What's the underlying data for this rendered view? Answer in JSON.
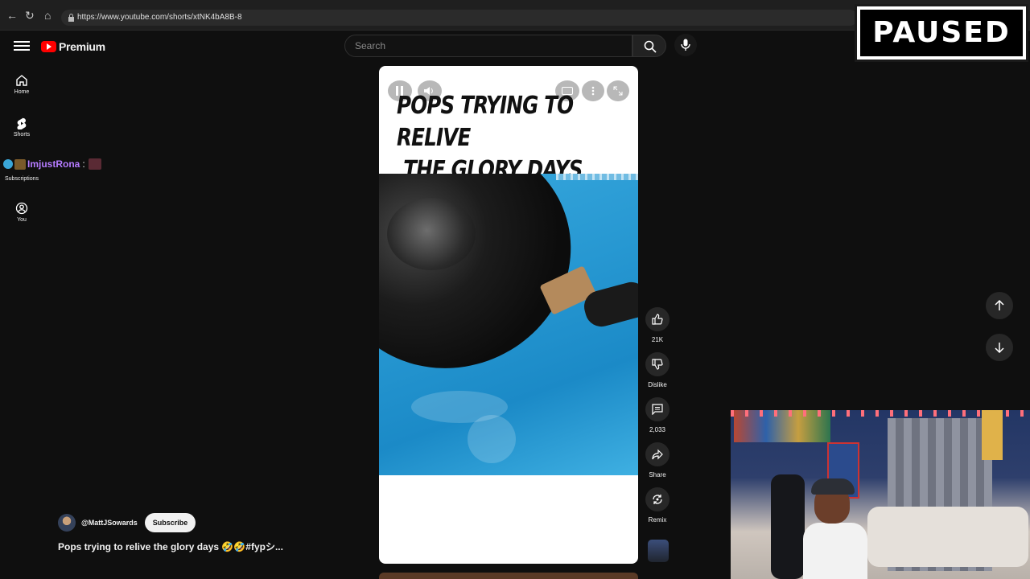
{
  "browser": {
    "url": "https://www.youtube.com/shorts/xtNK4bA8B-8"
  },
  "masthead": {
    "logo_text": "Premium",
    "search_placeholder": "Search"
  },
  "sidebar": {
    "items": [
      {
        "label": "Home",
        "icon": "home-icon"
      },
      {
        "label": "Shorts",
        "icon": "shorts-icon"
      },
      {
        "label": "Subscriptions",
        "icon": "subscriptions-icon"
      },
      {
        "label": "You",
        "icon": "account-icon"
      }
    ]
  },
  "chat_overlay": {
    "username": "ImjustRona",
    "separator": ":"
  },
  "short": {
    "caption_line1": "POPS TRYING TO RELIVE",
    "caption_line2": "THE GLORY DAYS",
    "channel_name": "@MattJSowards",
    "subscribe_label": "Subscribe",
    "title": "Pops trying to relive the glory days 🤣🤣#fypシ..."
  },
  "actions": {
    "like_count": "21K",
    "dislike_label": "Dislike",
    "comment_count": "2,033",
    "share_label": "Share",
    "remix_label": "Remix"
  },
  "overlay": {
    "paused_text": "PAUSED"
  },
  "colors": {
    "accent_red": "#ff0000",
    "background": "#0f0f0f",
    "chat_name": "#b57bff"
  }
}
